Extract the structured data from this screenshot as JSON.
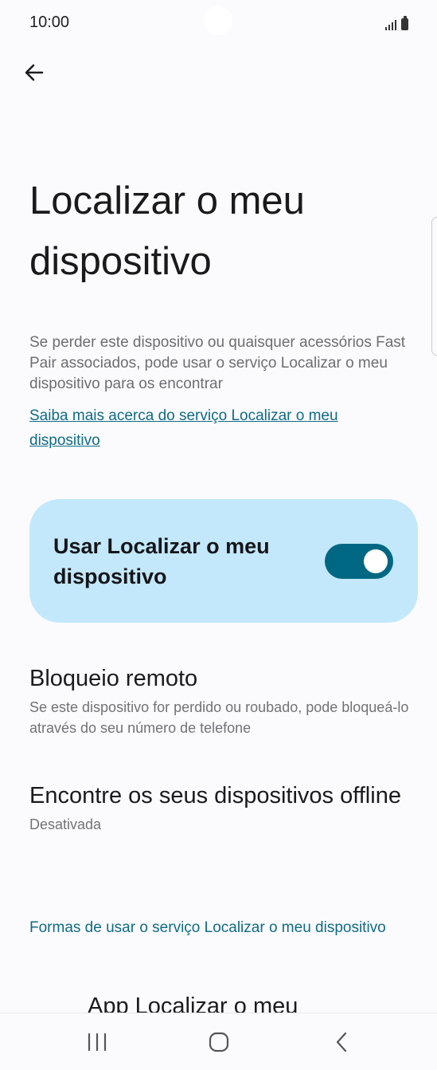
{
  "status_bar": {
    "time": "10:00"
  },
  "header": {
    "back_icon": "arrow-left-icon",
    "title": "Localizar o meu dispositivo"
  },
  "intro": {
    "description": "Se perder este dispositivo ou quaisquer acessórios Fast Pair associados, pode usar o serviço Localizar o meu dispositivo para os encontrar",
    "learn_more_link": "Saiba mais acerca do serviço Localizar o meu dispositivo"
  },
  "main_toggle": {
    "label": "Usar Localizar o meu dispositivo",
    "enabled": true,
    "accent_color": "#006783",
    "card_color": "#c3e8fb"
  },
  "settings": [
    {
      "title": "Bloqueio remoto",
      "subtitle": "Se este dispositivo for perdido ou roubado, pode bloqueá-lo através do seu número de telefone"
    },
    {
      "title": "Encontre os seus dispositivos offline",
      "subtitle": "Desativada"
    }
  ],
  "ways_link": "Formas de usar o serviço Localizar o meu dispositivo",
  "cutoff_item": "App Localizar o meu",
  "nav_bar": {
    "recents_icon": "recents-icon",
    "home_icon": "home-icon",
    "back_icon": "back-chevron-icon"
  },
  "colors": {
    "link": "#0f6b83",
    "background": "#fbfbfe"
  }
}
